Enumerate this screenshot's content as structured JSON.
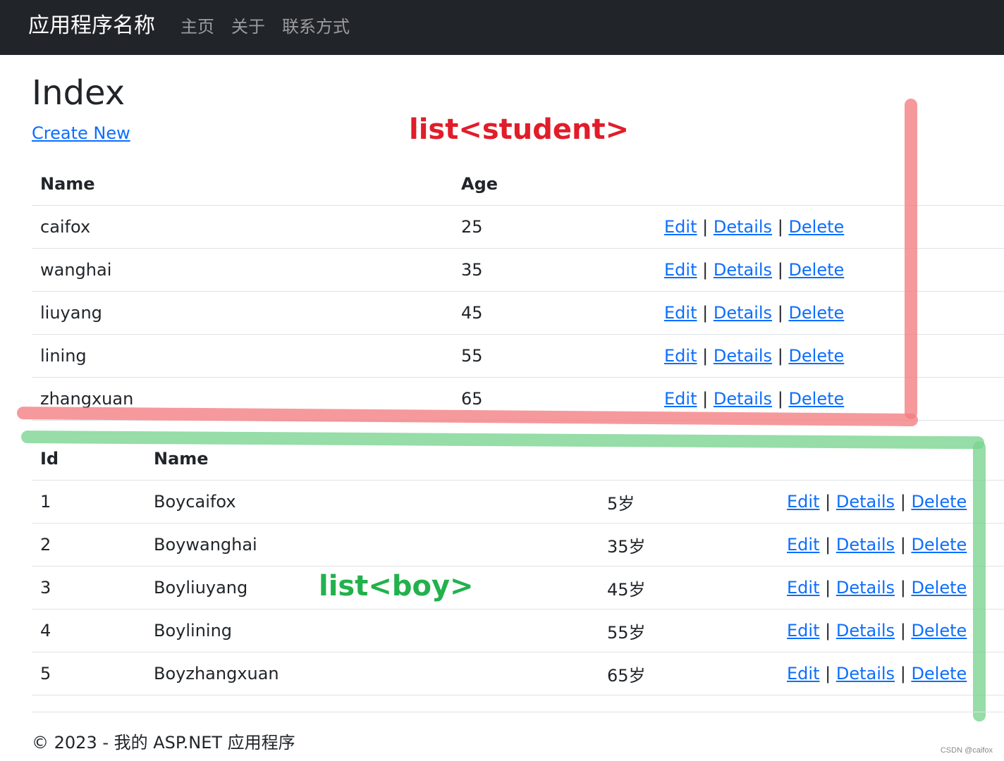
{
  "navbar": {
    "brand": "应用程序名称",
    "links": [
      "主页",
      "关于",
      "联系方式"
    ]
  },
  "page": {
    "title": "Index",
    "create_new": "Create New"
  },
  "student_table": {
    "headers": [
      "Name",
      "Age",
      ""
    ],
    "rows": [
      {
        "name": "caifox",
        "age": "25"
      },
      {
        "name": "wanghai",
        "age": "35"
      },
      {
        "name": "liuyang",
        "age": "45"
      },
      {
        "name": "lining",
        "age": "55"
      },
      {
        "name": "zhangxuan",
        "age": "65"
      }
    ]
  },
  "boy_table": {
    "headers": [
      "Id",
      "Name",
      "",
      ""
    ],
    "rows": [
      {
        "id": "1",
        "name": "Boycaifox",
        "age": "5岁"
      },
      {
        "id": "2",
        "name": "Boywanghai",
        "age": "35岁"
      },
      {
        "id": "3",
        "name": "Boyliuyang",
        "age": "45岁"
      },
      {
        "id": "4",
        "name": "Boylining",
        "age": "55岁"
      },
      {
        "id": "5",
        "name": "Boyzhangxuan",
        "age": "65岁"
      }
    ]
  },
  "actions": {
    "edit": "Edit",
    "details": "Details",
    "delete": "Delete",
    "separator": "|"
  },
  "footer": {
    "text": "© 2023 - 我的 ASP.NET 应用程序"
  },
  "annotations": {
    "student_label": "list<student>",
    "boy_label": "list<boy>",
    "student_color": "#e11d2a",
    "boy_color": "#22b14c",
    "red_stroke_color": "#f47c80",
    "green_stroke_color": "#78d38f"
  },
  "watermark": "CSDN @caifox",
  "colors": {
    "navbar_bg": "#212529",
    "link": "#0d6efd",
    "text": "#212529",
    "border": "#dee2e6"
  }
}
